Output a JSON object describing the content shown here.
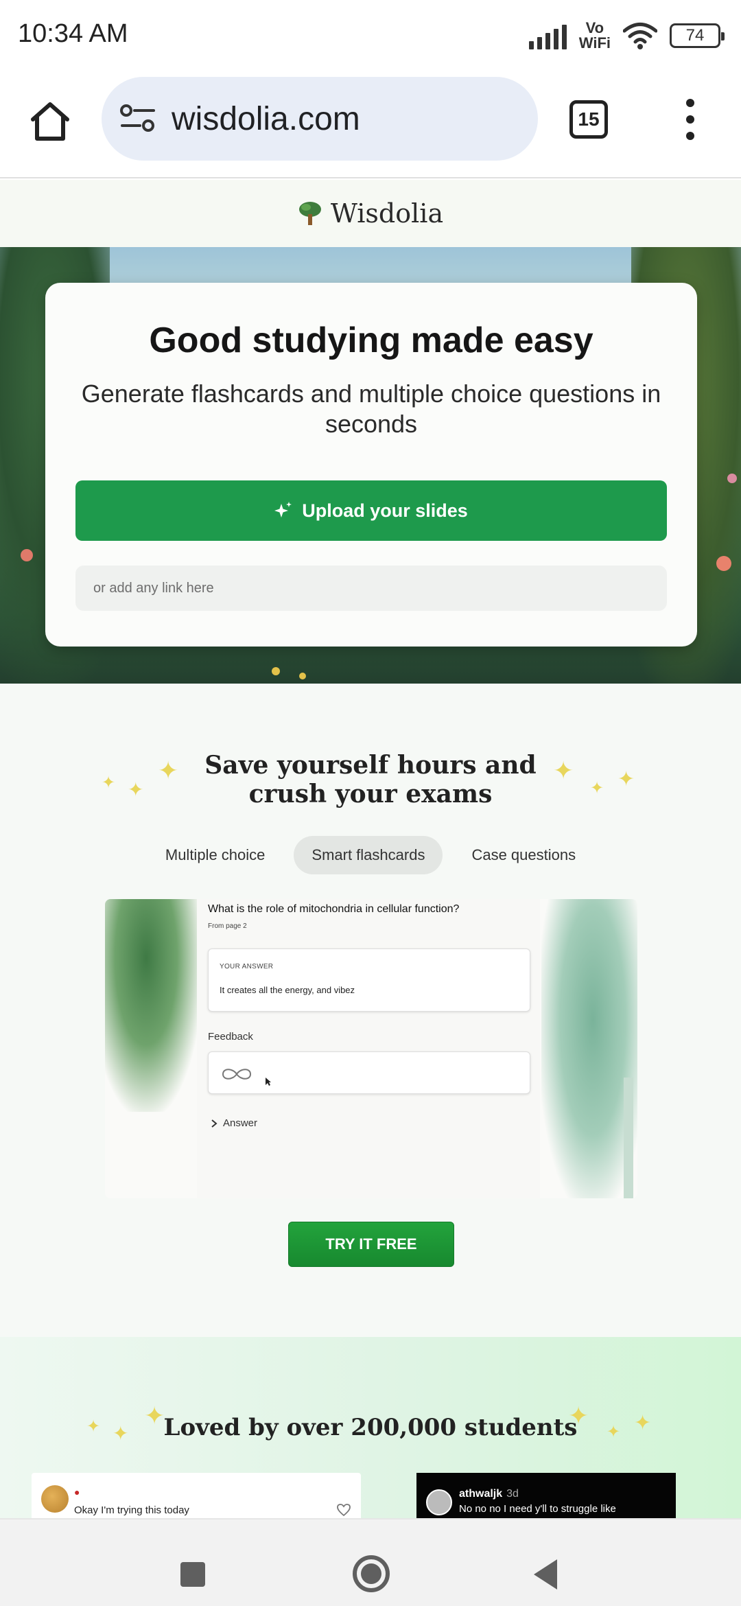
{
  "status_bar": {
    "time": "10:34 AM",
    "network_label_top": "Vo",
    "network_label_bottom": "WiFi",
    "battery": "74"
  },
  "browser": {
    "url": "wisdolia.com",
    "tab_count": "15"
  },
  "site": {
    "logo_text": "Wisdolia"
  },
  "hero": {
    "title": "Good studying made easy",
    "subtitle": "Generate flashcards and multiple choice questions in seconds",
    "upload_label": "Upload your slides",
    "link_placeholder": "or add any link here"
  },
  "features": {
    "title_line1": "Save yourself hours and",
    "title_line2": "crush your exams",
    "tabs": [
      {
        "label": "Multiple choice",
        "active": false
      },
      {
        "label": "Smart flashcards",
        "active": true
      },
      {
        "label": "Case questions",
        "active": false
      }
    ],
    "demo": {
      "question": "What is the role of mitochondria in cellular function?",
      "page_ref": "From page 2",
      "your_answer_label": "YOUR ANSWER",
      "your_answer": "It creates all the energy, and vibez",
      "feedback_label": "Feedback",
      "answer_toggle": "Answer"
    },
    "cta": "TRY IT FREE"
  },
  "testimonials": {
    "title": "Loved by over 200,000 students",
    "card1_text": "Okay I'm trying this today",
    "card2_user": "athwaljk",
    "card2_age": "3d",
    "card2_text": "No no no I need y'll to struggle like"
  },
  "colors": {
    "accent_green": "#1e9a4c",
    "sparkle_yellow": "#e8d65c"
  }
}
